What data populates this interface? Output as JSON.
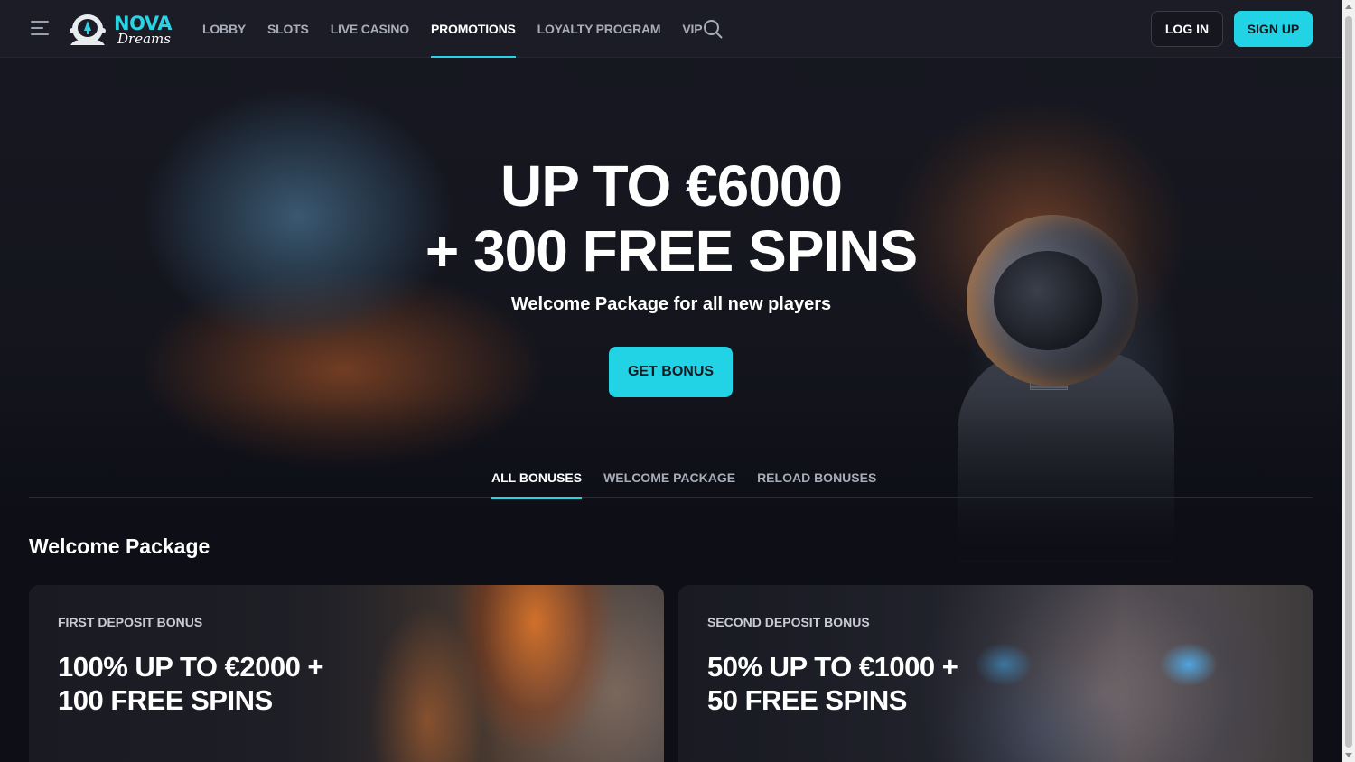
{
  "brand": {
    "name_line_1": "NOVA",
    "name_line_2": "Dreams",
    "accent_color": "#22d3e6"
  },
  "nav": {
    "items": [
      {
        "label": "LOBBY",
        "active": false
      },
      {
        "label": "SLOTS",
        "active": false
      },
      {
        "label": "LIVE CASINO",
        "active": false
      },
      {
        "label": "PROMOTIONS",
        "active": true
      },
      {
        "label": "LOYALTY PROGRAM",
        "active": false
      },
      {
        "label": "VIP",
        "active": false
      }
    ],
    "search_icon": "search-icon",
    "menu_icon": "hamburger-menu-icon"
  },
  "auth": {
    "login_label": "LOG IN",
    "signup_label": "SIGN UP"
  },
  "hero": {
    "title_line_1": "UP TO €6000",
    "title_line_2": "+ 300 FREE SPINS",
    "subtitle": "Welcome Package for all new players",
    "cta_label": "GET BONUS"
  },
  "tabs": {
    "items": [
      {
        "label": "ALL BONUSES",
        "active": true
      },
      {
        "label": "WELCOME PACKAGE",
        "active": false
      },
      {
        "label": "RELOAD BONUSES",
        "active": false
      }
    ]
  },
  "section": {
    "title": "Welcome Package"
  },
  "cards": [
    {
      "label": "FIRST DEPOSIT BONUS",
      "title_line_1": "100% UP TO €2000 +",
      "title_line_2": "100 FREE SPINS"
    },
    {
      "label": "SECOND DEPOSIT BONUS",
      "title_line_1": "50% UP TO €1000 +",
      "title_line_2": "50 FREE SPINS"
    }
  ]
}
